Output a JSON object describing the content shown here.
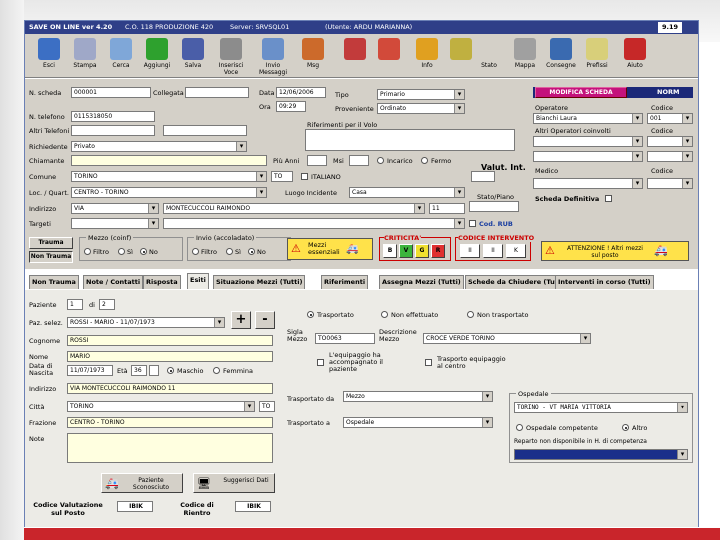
{
  "window": {
    "title_app": "SAVE ON LINE ver 4.20",
    "title_co": "C.O. 118 PRODUZIONE 420",
    "title_server": "Server: SRVSQL01",
    "title_user": "(Utente: ARDU MARIANNA)",
    "version_tag": "9.19"
  },
  "toolbar": [
    {
      "label": "Esci",
      "icon": "exit-door-icon",
      "color": "#3c6fc4"
    },
    {
      "label": "Stampa",
      "icon": "printer-icon",
      "color": "#9fa8c8"
    },
    {
      "label": "Cerca",
      "icon": "magnifier-icon",
      "color": "#7fa7d8"
    },
    {
      "label": "Aggiungi",
      "icon": "plus-icon",
      "color": "#2ea12e"
    },
    {
      "label": "Salva",
      "icon": "floppy-icon",
      "color": "#4a5ea8"
    },
    {
      "label": "Inserisci Voce",
      "icon": "vehicles-icon",
      "color": "#8c8c8c"
    },
    {
      "label": "Invio Messaggi",
      "icon": "network-icon",
      "color": "#6a90c9"
    },
    {
      "label": "Msg",
      "icon": "pencil-icon",
      "color": "#cc6a2b"
    },
    {
      "label": "",
      "icon": "book-icon",
      "color": "#c23b3b"
    },
    {
      "label": "",
      "icon": "phone-icon",
      "color": "#d24a3a"
    },
    {
      "label": "Info",
      "icon": "target-icon",
      "color": "#e0a020"
    },
    {
      "label": "",
      "icon": "calendar-icon",
      "color": "#c0b040"
    },
    {
      "label": "Stato",
      "icon": "blank-icon",
      "color": "#d4d0c8"
    },
    {
      "label": "Mappa",
      "icon": "map-icon",
      "color": "#a0a0a0"
    },
    {
      "label": "Consegne",
      "icon": "dragon-icon",
      "color": "#3a6ab0"
    },
    {
      "label": "Prefissi",
      "icon": "fax-icon",
      "color": "#d8cf7a"
    },
    {
      "label": "Aiuto",
      "icon": "help-icon",
      "color": "#c62828"
    }
  ],
  "form": {
    "n_scheda_label": "N. scheda",
    "n_scheda": "000001",
    "collegata_label": "Collegata",
    "data_label": "Data",
    "data": "12/06/2006",
    "ora_label": "Ora",
    "ora": "09:29",
    "tipo_label": "Tipo",
    "tipo": "Primario",
    "proveniente_label": "Proveniente",
    "proveniente": "Ordinato",
    "telefono_label": "N. telefono",
    "telefono": "0115318050",
    "altri_tel_label": "Altri Telefoni",
    "riferimenti_label": "Riferimenti per il Volo",
    "richiedente_label": "Richiedente",
    "richiedente": "Privato",
    "chiamante_label": "Chiamante",
    "piu_anni_label": "Più Anni",
    "msi_label": "Msi",
    "incarico_label": "Incarico",
    "fermo_label": "Fermo",
    "valut_label": "Valut. Int.",
    "comune_label": "Comune",
    "comune": "TORINO",
    "prov": "TO",
    "italiano_label": "ITALIANO",
    "loc_label": "Loc. / Quart.",
    "loc": "CENTRO - TORINO",
    "luogo_label": "Luogo Incidente",
    "luogo": "Casa",
    "indirizzo_label": "Indirizzo",
    "via": "VIA",
    "indirizzo": "MONTECUCCOLI RAIMONDO",
    "civico": "11",
    "stato_label": "Stato/Piano",
    "targeti_label": "Targeti",
    "cod_rub_label": "Cod. RUB",
    "trauma_btn": "Trauma",
    "non_trauma_btn": "Non Trauma",
    "mezzo_label": "Mezzo (coinf)",
    "filtro_label": "Filtro",
    "si_label": "Sì",
    "no_label": "No",
    "invio_label": "Invio (accoladato)",
    "mezzi_ess_label": "Mezzi essenziali",
    "criticita_label": "CRITICITA'",
    "codes": [
      "B",
      "V",
      "G",
      "R"
    ],
    "codice_int_label": "CODICE INTERVENTO",
    "codici": [
      "II",
      "II",
      "K"
    ],
    "attenzione_label": "ATTENZIONE ! Altri mezzi sul posto"
  },
  "right_panel": {
    "modifica_label": "MODIFICA SCHEDA",
    "norm_label": "NORM",
    "operatore_label": "Operatore",
    "operatore": "Bianchi Laura",
    "codice_label": "Codice",
    "codice": "001",
    "altri_op_label": "Altri Operatori coinvolti",
    "codice2_label": "Codice",
    "medico_label": "Medico",
    "codice3_label": "Codice",
    "scheda_def_label": "Scheda Definitiva"
  },
  "tabs": [
    "Non Trauma",
    "Note / Contatti",
    "Risposta",
    "Esiti",
    "Situazione Mezzi (Tutti)",
    "Riferimenti",
    "Assegna Mezzi (Tutti)",
    "Schede da Chiudere (Tutti)",
    "Interventi in corso (Tutti)"
  ],
  "esiti": {
    "paziente_label": "Paziente",
    "paziente": "1",
    "di_label": "di",
    "di": "2",
    "paz_sel_label": "Paz. selez.",
    "paz_sel": "ROSSI - MARIO - 11/07/1973",
    "plus": "+",
    "minus": "-",
    "trasportato_label": "Trasportato",
    "non_eff_label": "Non effettuato",
    "non_trasp_label": "Non trasportato",
    "cognome_label": "Cognome",
    "cognome": "ROSSI",
    "nome_label": "Nome",
    "nome": "MARIO",
    "nascita_label": "Data di Nascita",
    "nascita": "11/07/1973",
    "eta_label": "Età",
    "eta": "36",
    "maschio_label": "Maschio",
    "femmina_label": "Femmina",
    "indirizzo_label": "Indirizzo",
    "indirizzo": "VIA MONTECUCCOLI RAIMONDO 11",
    "citta_label": "Città",
    "citta": "TORINO",
    "prov": "TO",
    "frazione_label": "Frazione",
    "frazione": "CENTRO - TORINO",
    "note_label": "Note",
    "sigla_label": "Sigla Mezzo",
    "sigla": "TO0063",
    "descr_label": "Descrizione Mezzo",
    "descr": "CROCE VERDE TORINO",
    "equip_label": "L'equipaggio ha accompagnato il paziente",
    "trasp_equip_label": "Trasporto equipaggio al centro",
    "trasp_da_label": "Trasportato da",
    "trasp_da": "Mezzo",
    "trasp_a_label": "Trasportato a",
    "trasp_a": "Ospedale",
    "ospedale_label": "Ospedale",
    "ospedale": "TORINO - VT MARIA VITTORIA",
    "osp_comp_label": "Ospedale competente",
    "altro_label": "Altro",
    "reparto_label": "Reparto non disponibile in H. di competenza",
    "paz_sconosciuto_label": "Paziente Sconosciuto",
    "suggerisci_label": "Suggerisci Dati",
    "cod_val_label": "Codice Valutazione sul Posto",
    "cod_val": "IBIK",
    "cod_rientro_label": "Codice di Rientro",
    "cod_rientro": "IBIK"
  }
}
